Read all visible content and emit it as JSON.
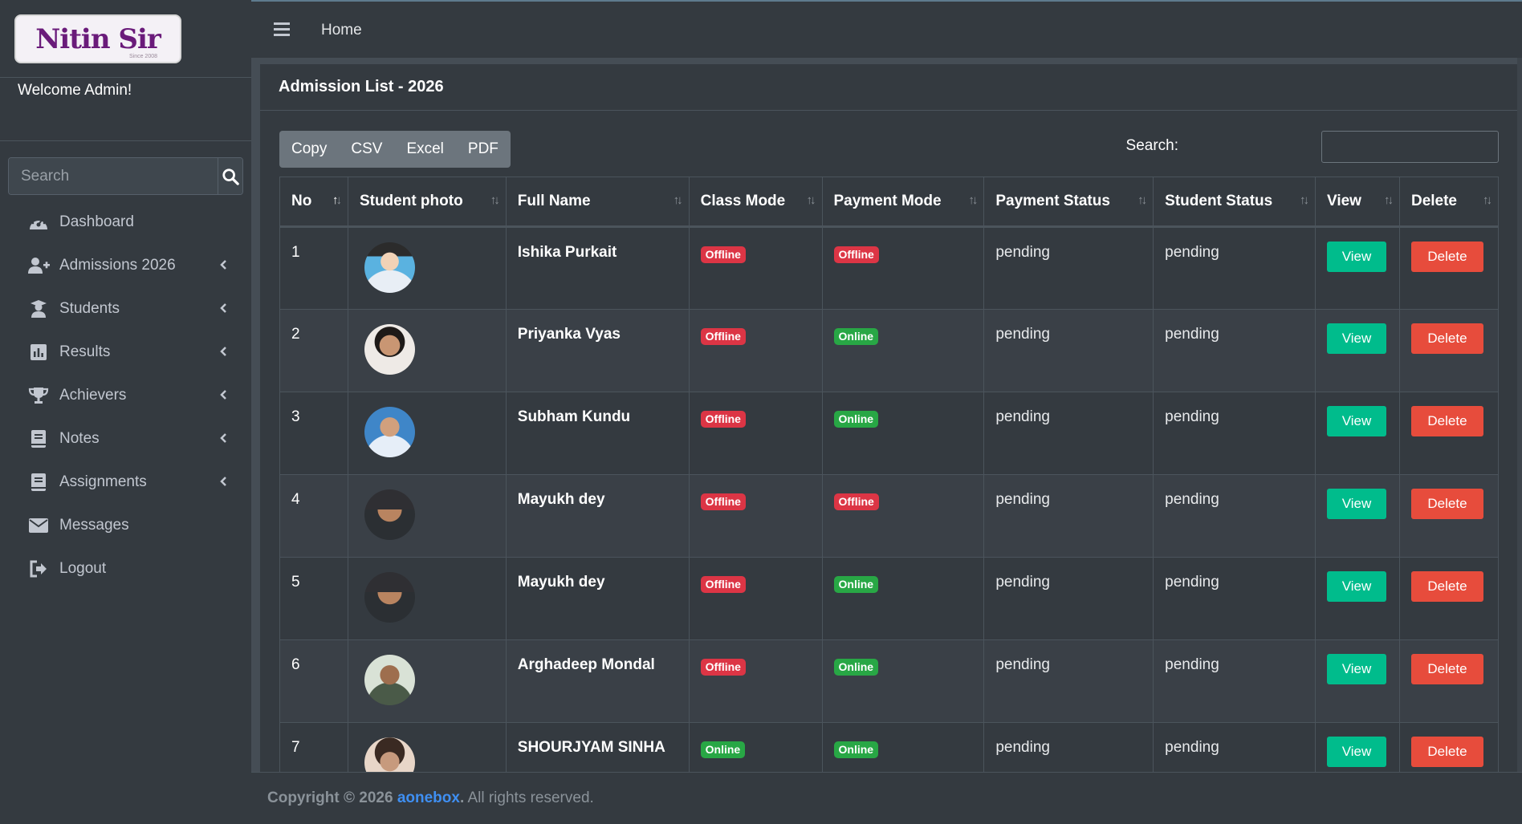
{
  "logo": {
    "text": "Nitin Sir",
    "tagline": "Since 2008"
  },
  "sidebar": {
    "welcome": "Welcome Admin!",
    "search_placeholder": "Search",
    "items": [
      {
        "label": "Dashboard",
        "icon": "dashboard-icon",
        "has_children": false
      },
      {
        "label": "Admissions 2026",
        "icon": "user-plus-icon",
        "has_children": true
      },
      {
        "label": "Students",
        "icon": "graduate-icon",
        "has_children": true
      },
      {
        "label": "Results",
        "icon": "chart-icon",
        "has_children": true
      },
      {
        "label": "Achievers",
        "icon": "trophy-icon",
        "has_children": true
      },
      {
        "label": "Notes",
        "icon": "book-icon",
        "has_children": true
      },
      {
        "label": "Assignments",
        "icon": "book-icon",
        "has_children": true
      },
      {
        "label": "Messages",
        "icon": "envelope-icon",
        "has_children": false
      },
      {
        "label": "Logout",
        "icon": "logout-icon",
        "has_children": false
      }
    ]
  },
  "topbar": {
    "home": "Home"
  },
  "card": {
    "title": "Admission List - 2026",
    "export_buttons": [
      "Copy",
      "CSV",
      "Excel",
      "PDF"
    ],
    "search_label": "Search:"
  },
  "table": {
    "columns": [
      "No",
      "Student photo",
      "Full Name",
      "Class Mode",
      "Payment Mode",
      "Payment Status",
      "Student Status",
      "View",
      "Delete"
    ],
    "rows": [
      {
        "no": "1",
        "name": "Ishika Purkait",
        "class_mode": "Offline",
        "payment_mode": "Offline",
        "payment_status": "pending",
        "student_status": "pending"
      },
      {
        "no": "2",
        "name": "Priyanka Vyas",
        "class_mode": "Offline",
        "payment_mode": "Online",
        "payment_status": "pending",
        "student_status": "pending"
      },
      {
        "no": "3",
        "name": "Subham Kundu",
        "class_mode": "Offline",
        "payment_mode": "Online",
        "payment_status": "pending",
        "student_status": "pending"
      },
      {
        "no": "4",
        "name": "Mayukh dey",
        "class_mode": "Offline",
        "payment_mode": "Offline",
        "payment_status": "pending",
        "student_status": "pending"
      },
      {
        "no": "5",
        "name": "Mayukh dey",
        "class_mode": "Offline",
        "payment_mode": "Online",
        "payment_status": "pending",
        "student_status": "pending"
      },
      {
        "no": "6",
        "name": "Arghadeep Mondal",
        "class_mode": "Offline",
        "payment_mode": "Online",
        "payment_status": "pending",
        "student_status": "pending"
      },
      {
        "no": "7",
        "name": "SHOURJYAM SINHA",
        "class_mode": "Online",
        "payment_mode": "Online",
        "payment_status": "pending",
        "student_status": "pending"
      }
    ],
    "view_label": "View",
    "delete_label": "Delete"
  },
  "footer": {
    "prefix": "Copyright © 2026",
    "brand": "aonebox",
    "dot": ".",
    "suffix": " All rights reserved."
  },
  "colors": {
    "view": "#00bc8c",
    "delete": "#e74c3c",
    "offline": "#dc3545",
    "online": "#28a745",
    "link": "#3f8ff2"
  }
}
